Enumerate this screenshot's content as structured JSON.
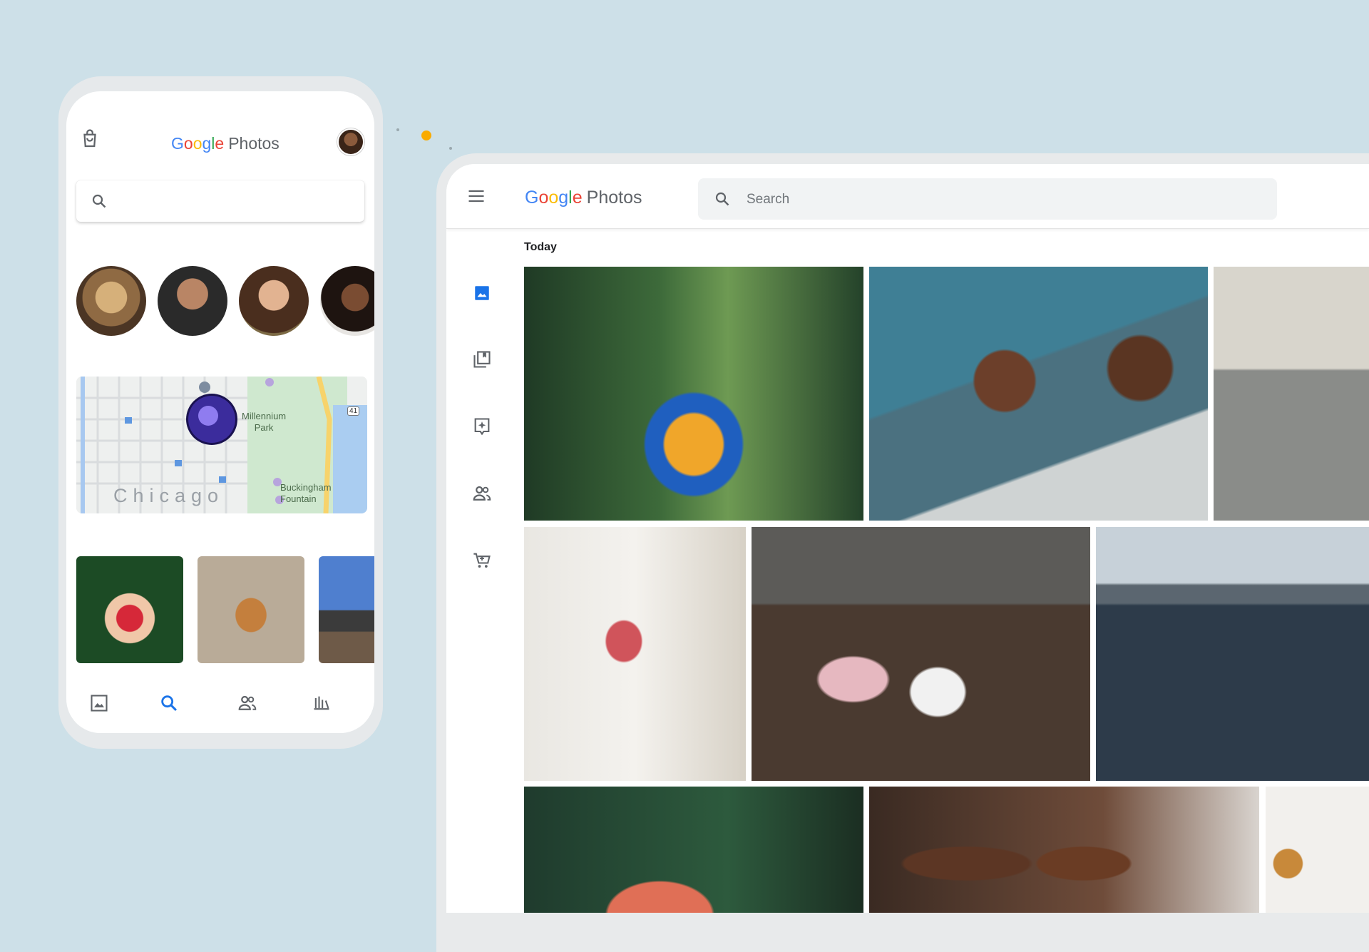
{
  "colors": {
    "background": "#cde0e8",
    "accent_blue": "#1a73e8",
    "icon_gray": "#5f6368",
    "dot_yellow": "#f9ab00"
  },
  "brand": {
    "google_letters": [
      "G",
      "o",
      "o",
      "g",
      "l",
      "e"
    ],
    "photos": "Photos"
  },
  "phone": {
    "header": {
      "bag_icon": "shopping-bag-icon",
      "avatar": "user-avatar"
    },
    "search": {
      "icon": "search-icon",
      "placeholder": ""
    },
    "people": [
      "dog",
      "man",
      "woman",
      "woman-2"
    ],
    "map": {
      "labels": {
        "park": "Millennium\nPark",
        "fountain": "Buckingham\nFountain",
        "city": "Chicago",
        "highway": "41"
      }
    },
    "thumbnails": [
      "strawberries",
      "dog-on-beach",
      "landscape"
    ],
    "bottom_nav": [
      {
        "name": "photos-icon",
        "active": false
      },
      {
        "name": "search-icon",
        "active": true
      },
      {
        "name": "sharing-icon",
        "active": false
      },
      {
        "name": "library-icon",
        "active": false
      }
    ]
  },
  "tablet": {
    "menu_icon": "menu-icon",
    "search": {
      "icon": "search-icon",
      "placeholder": "Search"
    },
    "sidebar": [
      {
        "name": "photos-icon",
        "active": true
      },
      {
        "name": "albums-icon",
        "active": false
      },
      {
        "name": "assistant-icon",
        "active": false
      },
      {
        "name": "sharing-icon",
        "active": false
      },
      {
        "name": "print-store-icon",
        "active": false
      }
    ],
    "section_label": "Today",
    "photos": [
      "child-on-shoulders-forest",
      "family-laughing-couch",
      "kitchen",
      "mother-daughter-living-room",
      "kids-playing-kitchen-floor",
      "boys-jumping-lake",
      "girl-with-sunglasses",
      "mother-and-son",
      "ornament"
    ]
  }
}
